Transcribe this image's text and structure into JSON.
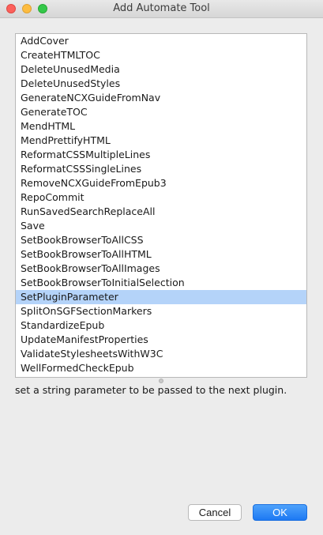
{
  "window": {
    "title": "Add Automate Tool"
  },
  "list": {
    "items": [
      "AddCover",
      "CreateHTMLTOC",
      "DeleteUnusedMedia",
      "DeleteUnusedStyles",
      "GenerateNCXGuideFromNav",
      "GenerateTOC",
      "MendHTML",
      "MendPrettifyHTML",
      "ReformatCSSMultipleLines",
      "ReformatCSSSingleLines",
      "RemoveNCXGuideFromEpub3",
      "RepoCommit",
      "RunSavedSearchReplaceAll",
      "Save",
      "SetBookBrowserToAllCSS",
      "SetBookBrowserToAllHTML",
      "SetBookBrowserToAllImages",
      "SetBookBrowserToInitialSelection",
      "SetPluginParameter",
      "SplitOnSGFSectionMarkers",
      "StandardizeEpub",
      "UpdateManifestProperties",
      "ValidateStylesheetsWithW3C",
      "WellFormedCheckEpub"
    ],
    "selected": "SetPluginParameter"
  },
  "description": "set a string parameter to be passed to the next plugin.",
  "buttons": {
    "cancel_label": "Cancel",
    "ok_label": "OK"
  },
  "colors": {
    "selection": "#b4d3f9",
    "accent": "#1d79f3"
  }
}
